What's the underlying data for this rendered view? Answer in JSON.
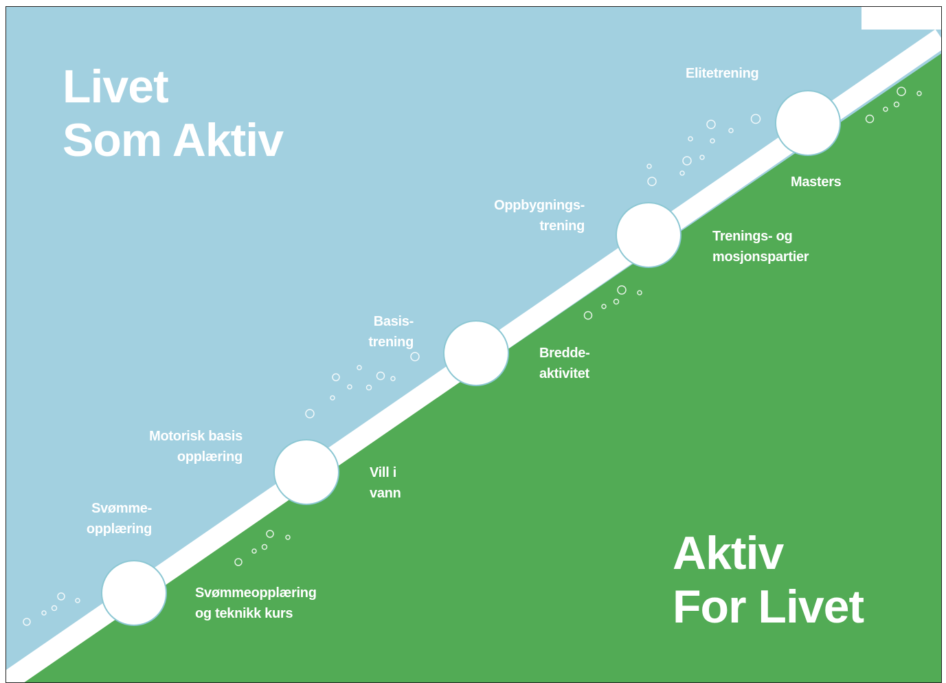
{
  "colors": {
    "sky": "#a2d0e0",
    "grass": "#52ab55",
    "path": "#ffffff",
    "node": "#ffffff",
    "text": "#ffffff"
  },
  "titles": {
    "top": [
      "Livet",
      "Som Aktiv"
    ],
    "bottom": [
      "Aktiv",
      "For Livet"
    ]
  },
  "stages": [
    {
      "upper": [
        "Svømme-",
        "opplæring"
      ],
      "lower": [
        "Svømmeopplæring",
        "og teknikk kurs"
      ]
    },
    {
      "upper": [
        "Motorisk basis",
        "opplæring"
      ],
      "lower": [
        "Vill i",
        "vann"
      ]
    },
    {
      "upper": [
        "Basis-",
        "trening"
      ],
      "lower": [
        "Bredde-",
        "aktivitet"
      ]
    },
    {
      "upper": [
        "Oppbygnings-",
        "trening"
      ],
      "lower": [
        "Trenings- og",
        "mosjonspartier"
      ]
    },
    {
      "upper": [
        "Elitetrening"
      ],
      "lower": [
        "Masters"
      ]
    }
  ]
}
